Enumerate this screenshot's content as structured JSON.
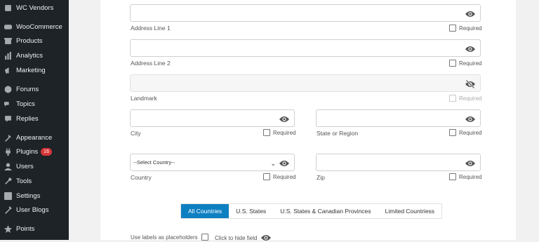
{
  "sidebar": {
    "items": [
      {
        "label": "WC Vendors",
        "icon": "vendors-icon"
      },
      {
        "label": "WooCommerce",
        "icon": "woocommerce-icon"
      },
      {
        "label": "Products",
        "icon": "products-icon"
      },
      {
        "label": "Analytics",
        "icon": "analytics-icon"
      },
      {
        "label": "Marketing",
        "icon": "marketing-icon"
      },
      {
        "label": "Forums",
        "icon": "forums-icon"
      },
      {
        "label": "Topics",
        "icon": "topics-icon"
      },
      {
        "label": "Replies",
        "icon": "replies-icon"
      },
      {
        "label": "Appearance",
        "icon": "appearance-icon"
      },
      {
        "label": "Plugins",
        "icon": "plugins-icon",
        "badge": "16"
      },
      {
        "label": "Users",
        "icon": "users-icon"
      },
      {
        "label": "Tools",
        "icon": "tools-icon"
      },
      {
        "label": "Settings",
        "icon": "settings-icon"
      },
      {
        "label": "User Blogs",
        "icon": "user-blogs-icon"
      },
      {
        "label": "Points",
        "icon": "points-icon"
      }
    ]
  },
  "form": {
    "required_label": "Required",
    "address1_label": "Address Line 1",
    "address2_label": "Address Line 2",
    "landmark_label": "Landmark",
    "city_label": "City",
    "state_label": "State or Region",
    "country_label": "Country",
    "country_select_value": "--Select Country--",
    "zip_label": "Zip"
  },
  "country_tabs": [
    "All Countries",
    "U.S. States",
    "U.S. States & Canadian Provinces",
    "Limited Countriess"
  ],
  "active_tab": "All Countries",
  "footer": {
    "placeholders_label": "Use labels as placeholders",
    "hide_field_label": "Click to hide field"
  },
  "colors": {
    "accent": "#0d80c2",
    "sidebar_bg": "#1d2327",
    "badge": "#d63638"
  }
}
